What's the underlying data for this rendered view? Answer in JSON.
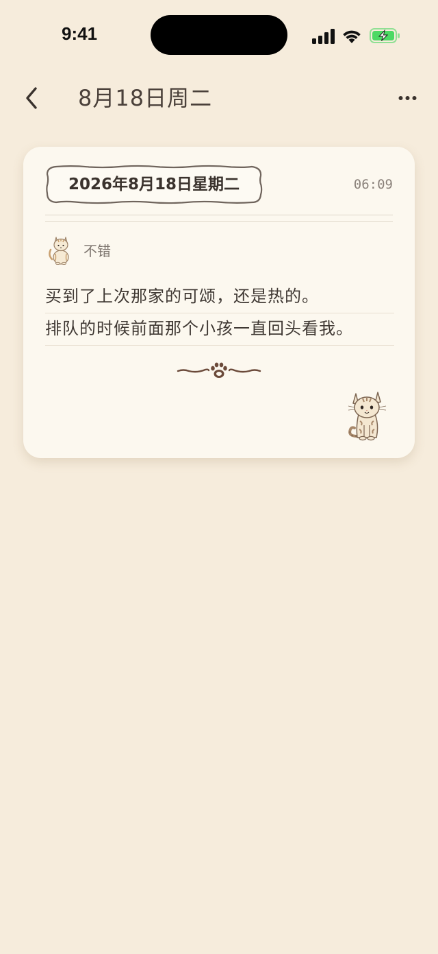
{
  "status_bar": {
    "time": "9:41"
  },
  "nav": {
    "title": "8月18日周二"
  },
  "entry": {
    "date_tag": "2026年8月18日星期二",
    "time": "06:09",
    "mood": "不错",
    "lines": [
      "买到了上次那家的可颂，还是热的。",
      "排队的时候前面那个小孩一直回头看我。"
    ]
  },
  "colors": {
    "background": "#f6ecdc",
    "card": "#fcf8ef",
    "text": "#3f3833",
    "muted": "#8a817a",
    "accent_brown": "#6b4a3a",
    "battery_green": "#4cd964"
  },
  "icons": {
    "back": "chevron-left-icon",
    "more": "more-horizontal-icon",
    "signal": "cellular-signal-icon",
    "wifi": "wifi-icon",
    "battery": "battery-charging-icon",
    "mood": "cat-icon",
    "divider": "paw-print-icon"
  }
}
